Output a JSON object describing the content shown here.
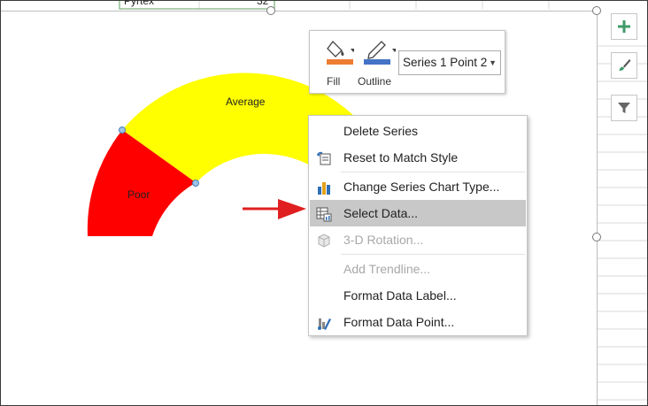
{
  "chart": {
    "gauge_labels": {
      "poor": "Poor",
      "average": "Average"
    },
    "colors": {
      "poor": "#ff0000",
      "average": "#ffff00",
      "good": "#92d050"
    }
  },
  "side_buttons": [
    {
      "icon": "plus-icon",
      "name": "chart-elements-button"
    },
    {
      "icon": "brush-icon",
      "name": "chart-styles-button"
    },
    {
      "icon": "filter-icon",
      "name": "chart-filters-button"
    }
  ],
  "mini_toolbar": {
    "fill_label": "Fill",
    "outline_label": "Outline",
    "series_select": "Series 1 Point 2",
    "fill_color": "#ed7d31",
    "outline_color": "#4472c4"
  },
  "context_menu": {
    "items": [
      {
        "label": "Delete Series",
        "icon": ""
      },
      {
        "label": "Reset to Match Style",
        "icon": "reset-style-icon"
      },
      {
        "label": "Change Series Chart Type...",
        "icon": "chart-type-icon"
      },
      {
        "label": "Select Data...",
        "icon": "select-data-icon",
        "highlighted": true
      },
      {
        "label": "3-D Rotation...",
        "icon": "cube-icon",
        "disabled": true
      },
      {
        "label": "Add Trendline...",
        "icon": "",
        "disabled": true
      },
      {
        "label": "Format Data Label...",
        "icon": ""
      },
      {
        "label": "Format Data Point...",
        "icon": "format-point-icon"
      }
    ]
  },
  "top_cells": {
    "partial_name": "Pyrtex",
    "partial_value": "32"
  },
  "accent": {
    "arrow": "#e02020",
    "highlight": "#c8c8c8"
  }
}
